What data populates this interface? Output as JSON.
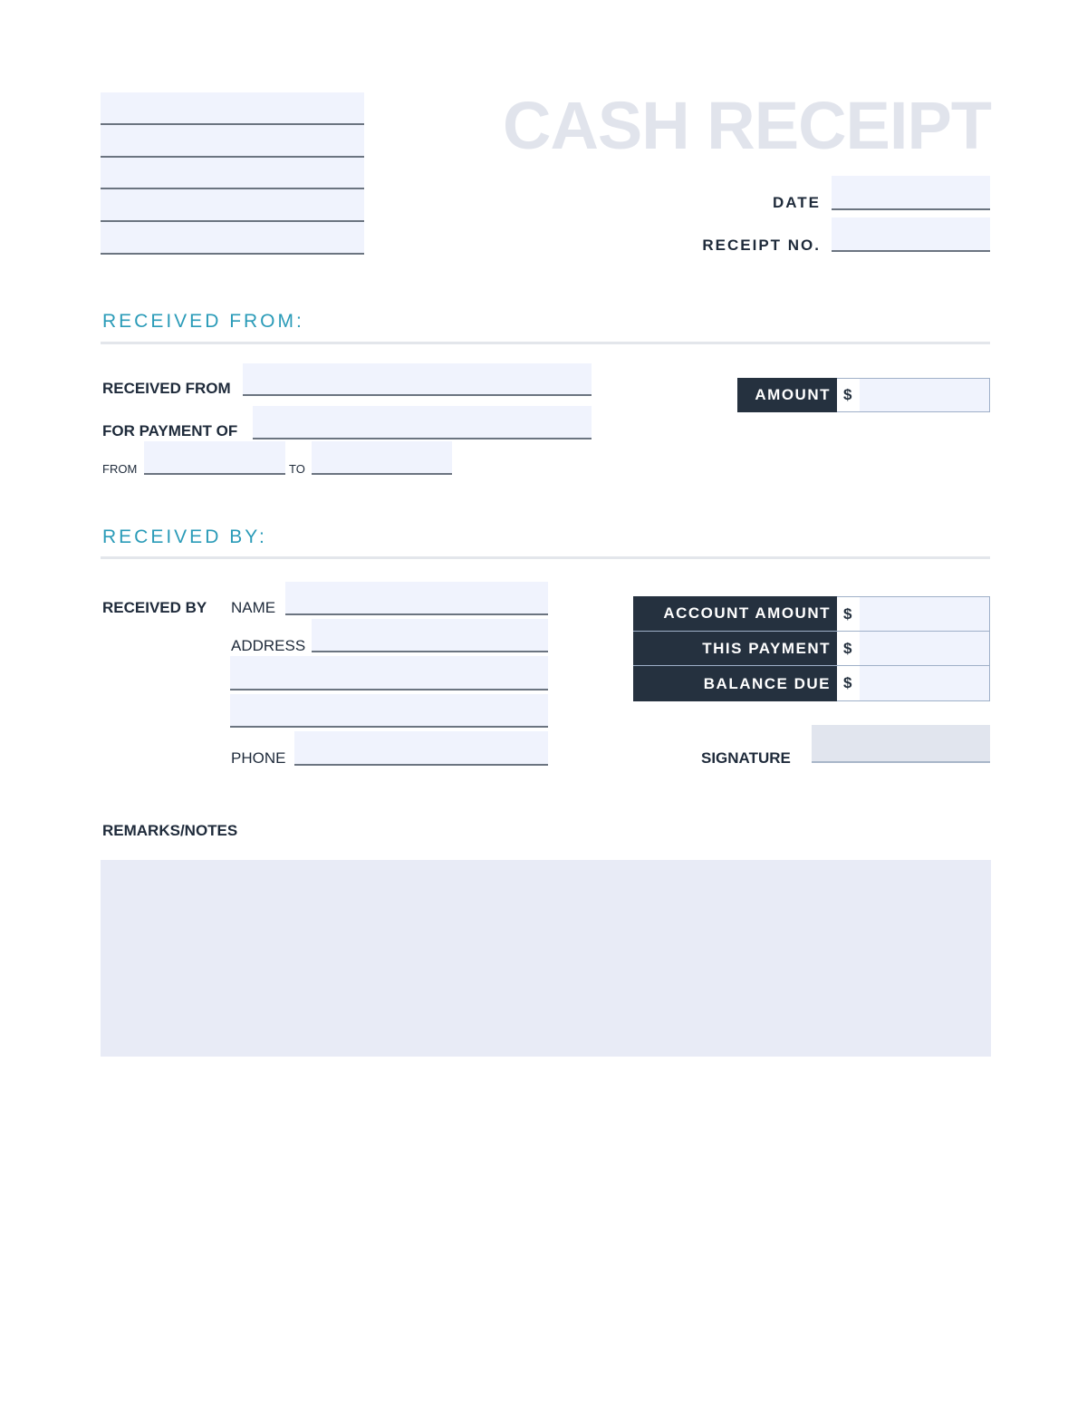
{
  "document": {
    "title": "CASH RECEIPT",
    "company_lines": [
      "",
      "",
      "",
      "",
      ""
    ],
    "date_label": "DATE",
    "date_value": "",
    "receipt_no_label": "RECEIPT NO.",
    "receipt_no_value": "",
    "colors": {
      "accent": "#2a9bb8",
      "dark": "#25313f",
      "field_fill": "#f0f3fd",
      "title": "#e1e4ec"
    }
  },
  "received_from_section": {
    "heading": "RECEIVED FROM:",
    "received_from_label": "RECEIVED FROM",
    "received_from_value": "",
    "for_payment_of_label": "FOR PAYMENT OF",
    "for_payment_of_value": "",
    "from_label": "FROM",
    "from_value": "",
    "to_label": "TO",
    "to_value": "",
    "amount_label": "AMOUNT",
    "amount_currency": "$",
    "amount_value": ""
  },
  "received_by_section": {
    "heading": "RECEIVED BY:",
    "received_by_label": "RECEIVED BY",
    "name_label": "NAME",
    "name_value": "",
    "address_label": "ADDRESS",
    "address_lines": [
      "",
      "",
      ""
    ],
    "phone_label": "PHONE",
    "phone_value": "",
    "summary": [
      {
        "label": "ACCOUNT AMOUNT",
        "currency": "$",
        "value": ""
      },
      {
        "label": "THIS PAYMENT",
        "currency": "$",
        "value": ""
      },
      {
        "label": "BALANCE DUE",
        "currency": "$",
        "value": ""
      }
    ],
    "signature_label": "SIGNATURE",
    "signature_value": ""
  },
  "remarks": {
    "label": "REMARKS/NOTES",
    "value": ""
  }
}
